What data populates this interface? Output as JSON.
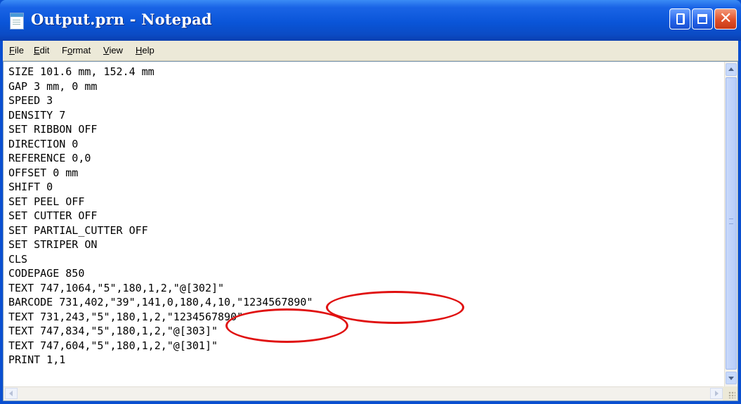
{
  "window": {
    "title": "Output.prn - Notepad"
  },
  "menu": [
    {
      "label": "File",
      "mnemonic": "F",
      "rest": "ile"
    },
    {
      "label": "Edit",
      "mnemonic": "E",
      "rest": "dit"
    },
    {
      "label": "Format",
      "mnemonic": "o",
      "pre": "F",
      "rest": "rmat"
    },
    {
      "label": "View",
      "mnemonic": "V",
      "rest": "iew"
    },
    {
      "label": "Help",
      "mnemonic": "H",
      "rest": "elp"
    }
  ],
  "document": {
    "lines": [
      "SIZE 101.6 mm, 152.4 mm",
      "GAP 3 mm, 0 mm",
      "SPEED 3",
      "DENSITY 7",
      "SET RIBBON OFF",
      "DIRECTION 0",
      "REFERENCE 0,0",
      "OFFSET 0 mm",
      "SHIFT 0",
      "SET PEEL OFF",
      "SET CUTTER OFF",
      "SET PARTIAL_CUTTER OFF",
      "SET STRIPER ON",
      "CLS",
      "CODEPAGE 850",
      "TEXT 747,1064,\"5\",180,1,2,\"@[302]\"",
      "BARCODE 731,402,\"39\",141,0,180,4,10,\"1234567890\"",
      "TEXT 731,243,\"5\",180,1,2,\"1234567890\"",
      "TEXT 747,834,\"5\",180,1,2,\"@[303]\"",
      "TEXT 747,604,\"5\",180,1,2,\"@[301]\"",
      "PRINT 1,1"
    ]
  },
  "colors": {
    "titlebar": "#0a55d8",
    "highlight": "#e01010"
  },
  "icons": {
    "app": "notepad-icon",
    "minimize": "minimize-icon",
    "maximize": "maximize-icon",
    "close": "close-icon"
  }
}
